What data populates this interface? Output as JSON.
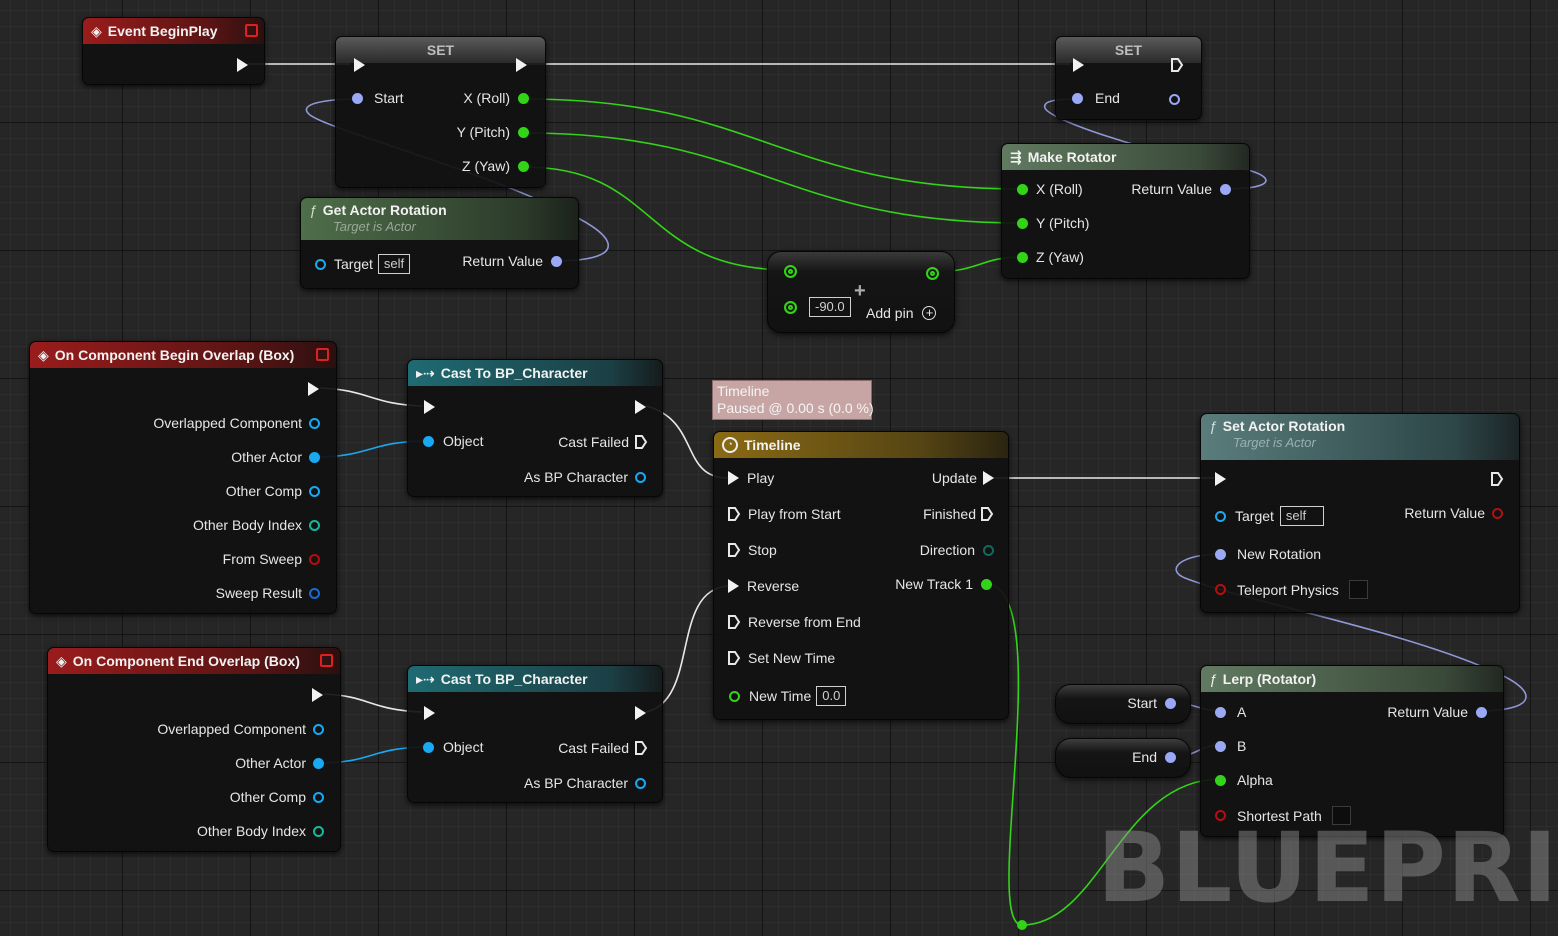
{
  "watermark": "BLUEPRINT",
  "event_beginplay": {
    "title": "Event BeginPlay"
  },
  "set1": {
    "title": "SET",
    "start": "Start",
    "x": "X (Roll)",
    "y": "Y (Pitch)",
    "z": "Z (Yaw)"
  },
  "set2": {
    "title": "SET",
    "end": "End"
  },
  "get_actor_rotation": {
    "title": "Get Actor Rotation",
    "subtitle": "Target is Actor",
    "target": "Target",
    "self": "self",
    "return": "Return Value"
  },
  "make_rotator": {
    "title": "Make Rotator",
    "x": "X (Roll)",
    "y": "Y (Pitch)",
    "z": "Z (Yaw)",
    "return": "Return Value"
  },
  "add_node": {
    "value": "-90.0",
    "add_pin": "Add pin"
  },
  "begin_overlap": {
    "title": "On Component Begin Overlap (Box)",
    "pins": [
      "Overlapped Component",
      "Other Actor",
      "Other Comp",
      "Other Body Index",
      "From Sweep",
      "Sweep Result"
    ]
  },
  "end_overlap": {
    "title": "On Component End Overlap (Box)",
    "pins": [
      "Overlapped Component",
      "Other Actor",
      "Other Comp",
      "Other Body Index"
    ]
  },
  "cast1": {
    "title": "Cast To BP_Character",
    "object": "Object",
    "failed": "Cast Failed",
    "as": "As BP Character"
  },
  "cast2": {
    "title": "Cast To BP_Character",
    "object": "Object",
    "failed": "Cast Failed",
    "as": "As BP Character"
  },
  "timeline_tooltip": {
    "line1": "Timeline",
    "line2": "Paused @ 0.00 s (0.0 %)"
  },
  "timeline": {
    "title": "Timeline",
    "inputs": [
      "Play",
      "Play from Start",
      "Stop",
      "Reverse",
      "Reverse from End",
      "Set New Time"
    ],
    "new_time": "New Time",
    "new_time_value": "0.0",
    "outputs": [
      "Update",
      "Finished",
      "Direction",
      "New Track 1"
    ]
  },
  "set_actor_rotation": {
    "title": "Set Actor Rotation",
    "subtitle": "Target is Actor",
    "target": "Target",
    "self": "self",
    "return": "Return Value",
    "new_rotation": "New Rotation",
    "teleport": "Teleport Physics"
  },
  "lerp": {
    "title": "Lerp (Rotator)",
    "a": "A",
    "b": "B",
    "alpha": "Alpha",
    "shortest": "Shortest Path",
    "return": "Return Value"
  },
  "var_start": {
    "label": "Start"
  },
  "var_end": {
    "label": "End"
  },
  "colors": {
    "exec": "#f2f2f2",
    "float": "#33d418",
    "struct": "#9aa8f5",
    "object": "#1aa8f0",
    "event_header": "#9a1c1c",
    "timeline_header": "#8a6a14"
  }
}
